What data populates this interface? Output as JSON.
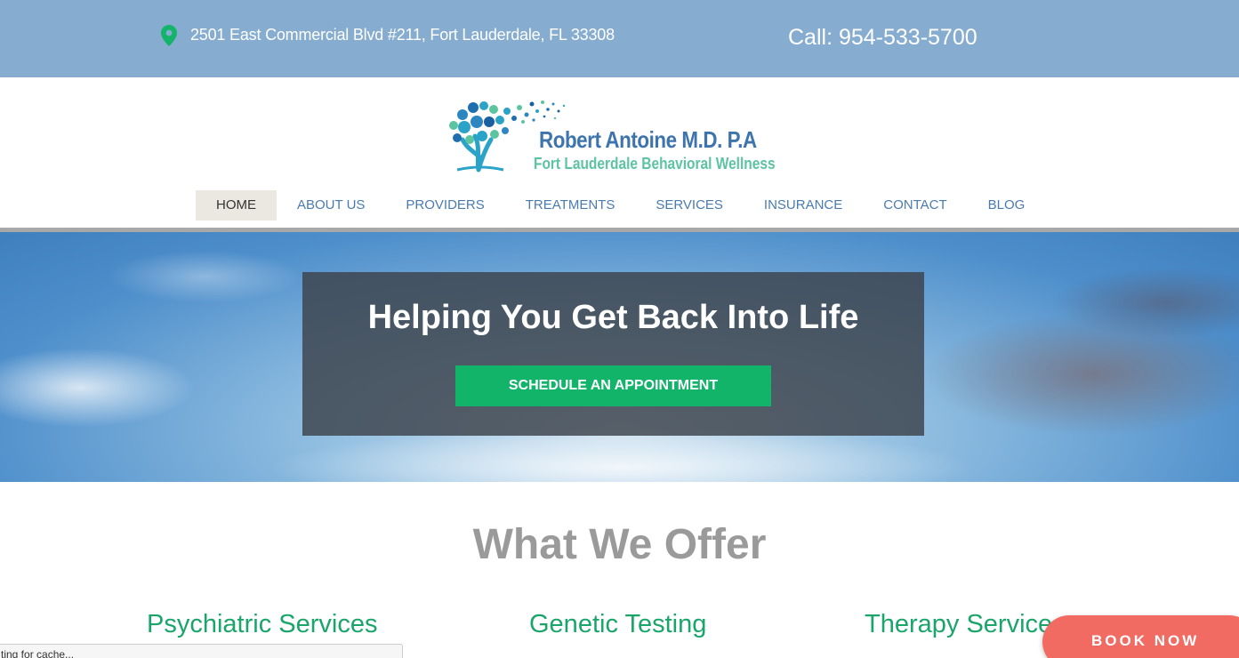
{
  "topbar": {
    "address": "2501 East Commercial Blvd #211, Fort Lauderdale, FL 33308",
    "phone": "Call: 954-533-5700",
    "pin_icon": "map-pin-icon",
    "pin_color": "#12b46a"
  },
  "logo": {
    "name": "Robert Antoine M.D. P.A",
    "subtitle": "Fort Lauderdale Behavioral Wellness"
  },
  "nav": {
    "items": [
      {
        "label": "HOME",
        "active": true
      },
      {
        "label": "ABOUT US"
      },
      {
        "label": "PROVIDERS"
      },
      {
        "label": "TREATMENTS"
      },
      {
        "label": "SERVICES"
      },
      {
        "label": "INSURANCE"
      },
      {
        "label": "CONTACT"
      },
      {
        "label": "BLOG"
      }
    ]
  },
  "hero": {
    "title": "Helping You Get Back Into Life",
    "cta_label": "SCHEDULE AN APPOINTMENT"
  },
  "offer": {
    "title": "What We Offer",
    "services": [
      "Psychiatric Services",
      "Genetic Testing",
      "Therapy Service"
    ]
  },
  "status_bar": {
    "text": "ting for cache..."
  },
  "book_button": {
    "label": "BOOK NOW"
  },
  "colors": {
    "topbar": "#86acd0",
    "nav_link": "#4a7bb0",
    "cta": "#12b46a",
    "service_heading": "#1aa56b",
    "book_now": "#f26b63"
  }
}
